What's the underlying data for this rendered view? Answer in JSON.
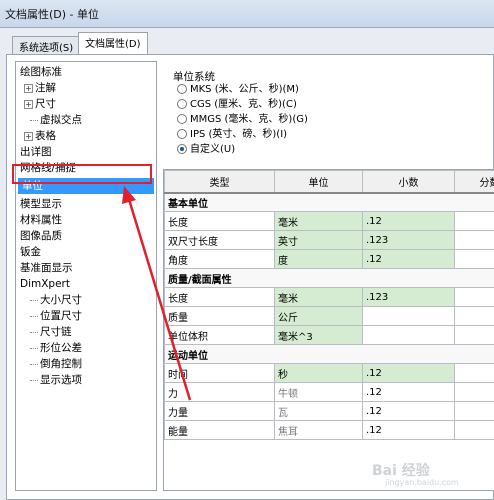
{
  "window": {
    "title": "文档属性(D) - 单位"
  },
  "tabs": [
    {
      "label": "系统选项(S)",
      "active": false
    },
    {
      "label": "文档属性(D)",
      "active": true
    }
  ],
  "tree": {
    "items": [
      {
        "label": "绘图标准",
        "level": 0,
        "expander": ""
      },
      {
        "label": "注解",
        "level": 1,
        "expander": "+"
      },
      {
        "label": "尺寸",
        "level": 1,
        "expander": "+"
      },
      {
        "label": "虚拟交点",
        "level": 2,
        "expander": ""
      },
      {
        "label": "表格",
        "level": 1,
        "expander": "+"
      },
      {
        "label": "出详图",
        "level": 0,
        "expander": ""
      },
      {
        "label": "网格线/捕捉",
        "level": 0,
        "expander": ""
      },
      {
        "label": "单位",
        "level": 0,
        "expander": "",
        "selected": true
      },
      {
        "label": "模型显示",
        "level": 0,
        "expander": ""
      },
      {
        "label": "材料属性",
        "level": 0,
        "expander": ""
      },
      {
        "label": "图像品质",
        "level": 0,
        "expander": ""
      },
      {
        "label": "钣金",
        "level": 0,
        "expander": ""
      },
      {
        "label": "基准面显示",
        "level": 0,
        "expander": ""
      },
      {
        "label": "DimXpert",
        "level": 0,
        "expander": ""
      },
      {
        "label": "大小尺寸",
        "level": 2,
        "expander": ""
      },
      {
        "label": "位置尺寸",
        "level": 2,
        "expander": ""
      },
      {
        "label": "尺寸链",
        "level": 2,
        "expander": ""
      },
      {
        "label": "形位公差",
        "level": 2,
        "expander": ""
      },
      {
        "label": "倒角控制",
        "level": 2,
        "expander": ""
      },
      {
        "label": "显示选项",
        "level": 2,
        "expander": ""
      }
    ]
  },
  "unit_system": {
    "title": "单位系统",
    "options": [
      {
        "label": "MKS (米、公斤、秒)(M)",
        "checked": false
      },
      {
        "label": "CGS (厘米、克、秒)(C)",
        "checked": false
      },
      {
        "label": "MMGS (毫米、克、秒)(G)",
        "checked": false
      },
      {
        "label": "IPS (英寸、磅、秒)(I)",
        "checked": false
      },
      {
        "label": "自定义(U)",
        "checked": true
      }
    ]
  },
  "units_table": {
    "columns": [
      "类型",
      "单位",
      "小数",
      "分数"
    ],
    "rows": [
      {
        "kind": "section",
        "type": "基本单位"
      },
      {
        "kind": "row",
        "type": "长度",
        "unit": "毫米",
        "decimal": ".12",
        "fraction": "",
        "unit_green": true,
        "decimal_green": true
      },
      {
        "kind": "row",
        "type": "双尺寸长度",
        "unit": "英寸",
        "decimal": ".123",
        "fraction": "",
        "unit_green": true,
        "decimal_green": true
      },
      {
        "kind": "row",
        "type": "角度",
        "unit": "度",
        "decimal": ".12",
        "fraction": "",
        "unit_green": true,
        "decimal_green": true
      },
      {
        "kind": "section",
        "type": "质量/截面属性"
      },
      {
        "kind": "row",
        "type": "长度",
        "unit": "毫米",
        "decimal": ".123",
        "fraction": "",
        "unit_green": true,
        "decimal_green": true
      },
      {
        "kind": "row",
        "type": "质量",
        "unit": "公斤",
        "decimal": "",
        "fraction": "",
        "unit_green": true,
        "decimal_green": false
      },
      {
        "kind": "row",
        "type": "单位体积",
        "unit": "毫米^3",
        "decimal": "",
        "fraction": "",
        "unit_green": true,
        "decimal_green": false
      },
      {
        "kind": "section",
        "type": "运动单位"
      },
      {
        "kind": "row",
        "type": "时间",
        "unit": "秒",
        "decimal": ".12",
        "fraction": "",
        "unit_green": true,
        "decimal_green": true
      },
      {
        "kind": "row",
        "type": "力",
        "unit": "牛顿",
        "decimal": ".12",
        "fraction": "",
        "unit_green": false,
        "decimal_green": false,
        "grey": true
      },
      {
        "kind": "row",
        "type": "力量",
        "unit": "瓦",
        "decimal": ".12",
        "fraction": "",
        "unit_green": false,
        "decimal_green": false,
        "grey": true
      },
      {
        "kind": "row",
        "type": "能量",
        "unit": "焦耳",
        "decimal": ".12",
        "fraction": "",
        "unit_green": false,
        "decimal_green": false,
        "grey": true
      }
    ]
  },
  "watermark": {
    "text": "Bai 经验",
    "url": "jingyan.baidu.com"
  },
  "colors": {
    "highlight": "#e0202a",
    "selection": "#3399ff",
    "green_cell": "#d6ecd2"
  }
}
